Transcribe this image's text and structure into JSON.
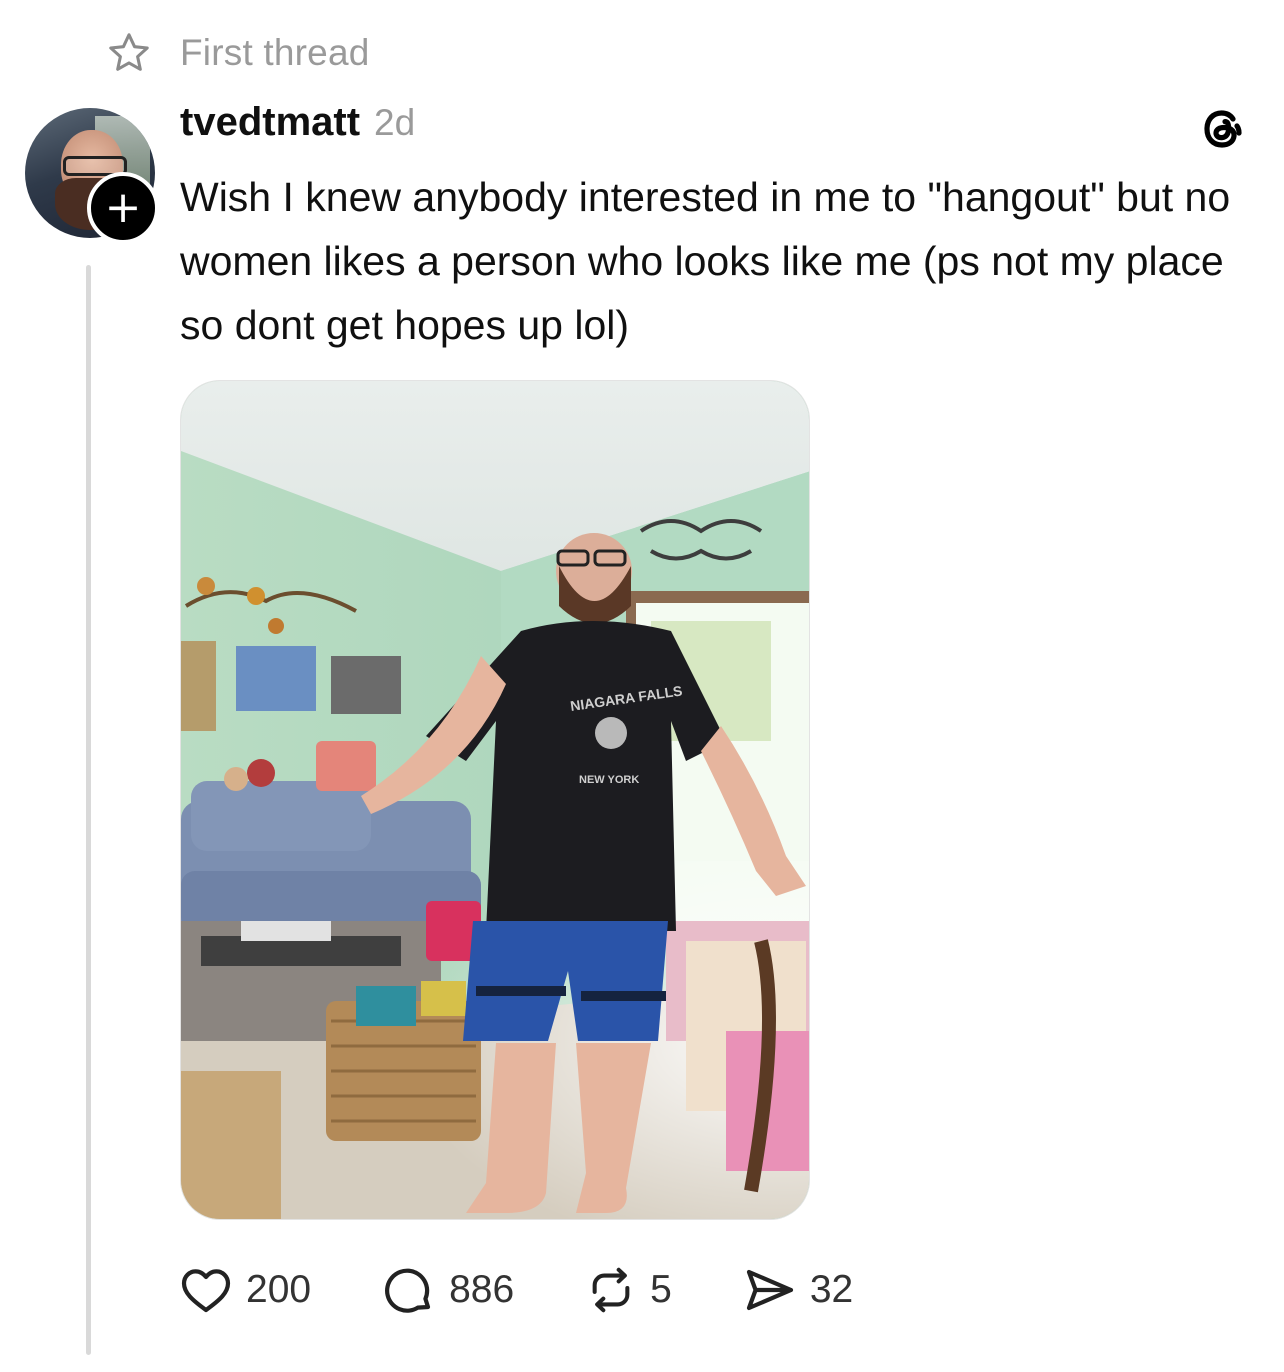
{
  "thread_header": {
    "label": "First thread",
    "icon": "star-icon"
  },
  "post": {
    "username": "tvedtmatt",
    "time": "2d",
    "text": "Wish I knew anybody interested in me to \"hangout\" but no women likes a person who looks like me (ps not my place so dont get hopes up lol)",
    "follow_badge": "+",
    "image_printed_text": [
      "NIAGARA FALLS",
      "NEW YORK"
    ]
  },
  "actions": {
    "likes": "200",
    "replies": "886",
    "reposts": "5",
    "shares": "32"
  },
  "colors": {
    "muted_text": "#9a9a9a",
    "thread_line": "#d9d9d9",
    "text": "#101010"
  }
}
